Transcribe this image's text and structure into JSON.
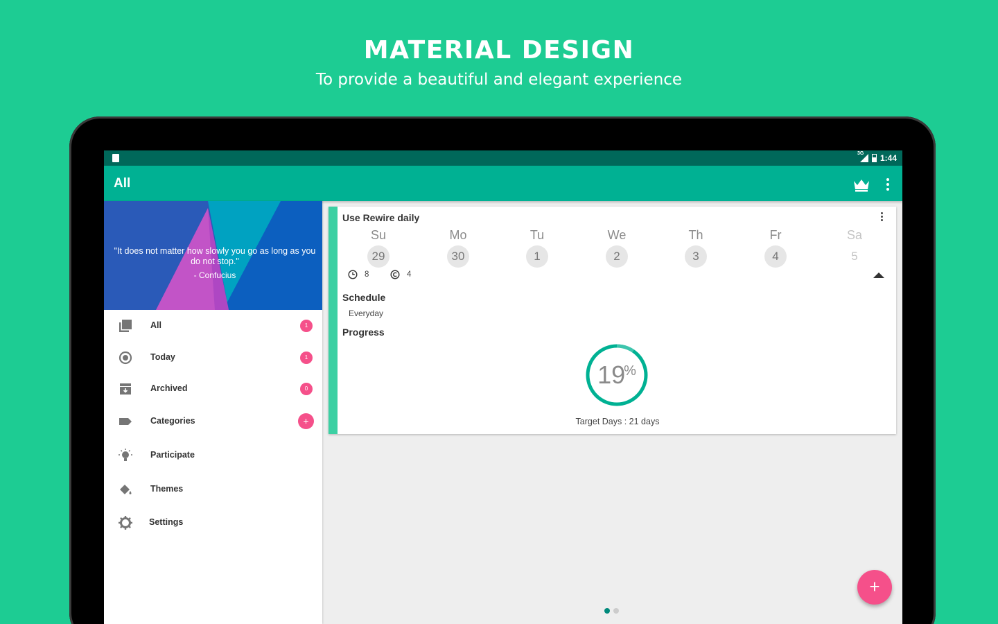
{
  "promo": {
    "title": "MATERIAL DESIGN",
    "subtitle": "To provide a beautiful and elegant experience"
  },
  "status_bar": {
    "time": "1:44",
    "network": "3G"
  },
  "app_bar": {
    "title": "All",
    "premium_icon": "crown-icon",
    "menu_icon": "more-vert-icon"
  },
  "drawer": {
    "quote": "\"It does not matter how slowly you go as long as you do not stop.\"",
    "author": "- Confucius",
    "items": [
      {
        "label": "All",
        "badge": "1",
        "icon": "library-icon"
      },
      {
        "label": "Today",
        "badge": "1",
        "icon": "radio-target-icon"
      },
      {
        "label": "Archived",
        "badge": "0",
        "icon": "archive-icon"
      },
      {
        "label": "Categories",
        "badge": "+",
        "icon": "label-icon"
      },
      {
        "label": "Participate",
        "badge": "",
        "icon": "bulb-icon"
      },
      {
        "label": "Themes",
        "badge": "",
        "icon": "paint-bucket-icon"
      },
      {
        "label": "Settings",
        "badge": "",
        "icon": "gear-icon"
      }
    ]
  },
  "habit_card": {
    "title": "Use Rewire daily",
    "days": [
      {
        "name": "Su",
        "num": "29"
      },
      {
        "name": "Mo",
        "num": "30"
      },
      {
        "name": "Tu",
        "num": "1"
      },
      {
        "name": "We",
        "num": "2"
      },
      {
        "name": "Th",
        "num": "3"
      },
      {
        "name": "Fr",
        "num": "4"
      },
      {
        "name": "Sa",
        "num": "5"
      }
    ],
    "current_streak": "8",
    "best_streak": "4",
    "schedule_label": "Schedule",
    "schedule_value": "Everyday",
    "progress_label": "Progress",
    "progress_value": "19",
    "progress_unit": "%",
    "progress_fraction": 0.19,
    "target_text": "Target Days : 21 days",
    "accent_color": "#3cd0a3",
    "ring_color": "#00b193"
  },
  "fab": {
    "label": "+"
  },
  "pager": {
    "pages": 2,
    "active": 0
  }
}
